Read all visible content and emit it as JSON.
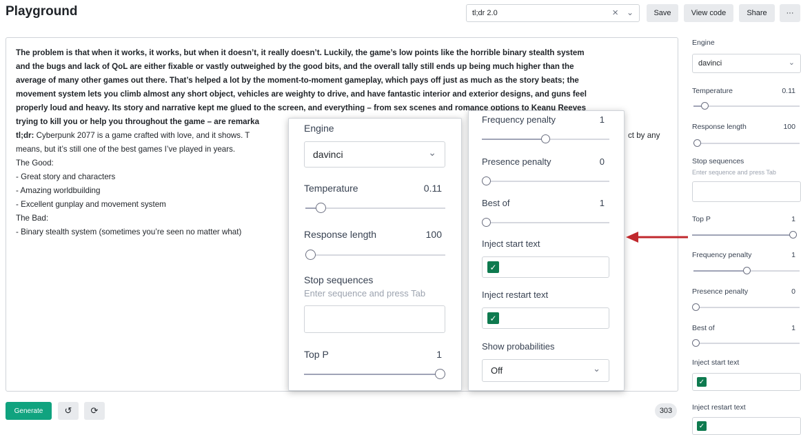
{
  "header": {
    "title": "Playground",
    "preset_value": "tl;dr 2.0",
    "save_label": "Save",
    "view_code_label": "View code",
    "share_label": "Share",
    "more_label": "···"
  },
  "editor": {
    "prompt_lines": [
      "The problem is that when it works, it works, but when it doesn’t, it really doesn’t. Luckily, the game’s low points like the horrible binary stealth system",
      "and the bugs and lack of QoL are either fixable or vastly outweighed by the good bits, and the overall tally still ends up being much higher than the",
      "average of many other games out there. That’s helped a lot by the moment-to-moment gameplay, which pays off just as much as the story beats; the",
      "movement system lets you climb almost any short object, vehicles are weighty to drive, and have fantastic interior and exterior designs, and guns feel",
      "properly loud and heavy. Its story and narrative kept me glued to the screen, and everything – from sex scenes and romance options to Keanu Reeves",
      "trying to kill you or help you throughout the game – are remarka"
    ],
    "tldr_label": "tl;dr:",
    "completion_first": " Cyberpunk 2077 is a game crafted with love, and it shows. T",
    "completion_first_tail": "ct by any",
    "completion_lines": [
      "means, but it’s still one of the best games I’ve played in years.",
      "The Good:",
      "- Great story and characters",
      "- Amazing worldbuilding",
      "- Excellent gunplay and movement system",
      "The Bad:",
      "- Binary stealth system (sometimes you’re seen no matter what)"
    ]
  },
  "footer": {
    "generate_label": "Generate",
    "undo_icon": "↺",
    "regenerate_icon": "⟳",
    "token_count": "303"
  },
  "sidebar": {
    "engine_label": "Engine",
    "engine_value": "davinci",
    "temperature_label": "Temperature",
    "temperature_value": "0.11",
    "temperature_fraction": 0.11,
    "response_length_label": "Response length",
    "response_length_value": "100",
    "response_length_fraction": 0.02,
    "stop_sequences_label": "Stop sequences",
    "stop_sequences_hint": "Enter sequence and press Tab",
    "top_p_label": "Top P",
    "top_p_value": "1",
    "top_p_fraction": 1.0,
    "frequency_penalty_label": "Frequency penalty",
    "frequency_penalty_value": "1",
    "frequency_penalty_fraction": 0.5,
    "presence_penalty_label": "Presence penalty",
    "presence_penalty_value": "0",
    "presence_penalty_fraction": 0.0,
    "best_of_label": "Best of",
    "best_of_value": "1",
    "best_of_fraction": 0.0,
    "inject_start_label": "Inject start text",
    "inject_restart_label": "Inject restart text",
    "show_probabilities_label": "Show probabilities",
    "show_probabilities_value": "Off",
    "check_glyph": "✓",
    "chevron_glyph": "⌄"
  },
  "colors": {
    "accent": "#10a37f",
    "checkbox": "#0e7a4f",
    "annotation_arrow": "#c0282d"
  }
}
